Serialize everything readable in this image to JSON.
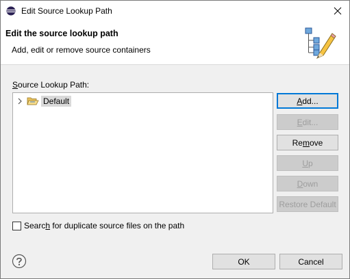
{
  "window": {
    "title": "Edit Source Lookup Path",
    "close_label": "×"
  },
  "header": {
    "title": "Edit the source lookup path",
    "description": "Add, edit or remove source containers"
  },
  "source_lookup": {
    "label_mnemonic": "S",
    "label_rest": "ource Lookup Path:",
    "tree": [
      {
        "label": "Default",
        "icon": "folder-open-icon",
        "expanded": false,
        "selected": true
      }
    ]
  },
  "buttons": {
    "add": {
      "mnemonic": "A",
      "rest": "dd...",
      "enabled": true
    },
    "edit": {
      "mnemonic": "E",
      "rest": "dit...",
      "enabled": false
    },
    "remove": {
      "pre": "Re",
      "mnemonic": "m",
      "rest": "ove",
      "enabled": true
    },
    "up": {
      "mnemonic": "U",
      "rest": "p",
      "enabled": false
    },
    "down": {
      "mnemonic": "D",
      "rest": "own",
      "enabled": false
    },
    "restore_default": {
      "label": "Restore Default",
      "enabled": false
    }
  },
  "duplicates_option": {
    "pre": "Searc",
    "mnemonic": "h",
    "rest": " for duplicate source files on the path",
    "checked": false
  },
  "footer": {
    "help_icon": "help-icon",
    "ok_label": "OK",
    "cancel_label": "Cancel"
  },
  "colors": {
    "accent": "#0078d7",
    "selection": "#d9d9d9",
    "disabled_text": "#9d9d9d"
  }
}
